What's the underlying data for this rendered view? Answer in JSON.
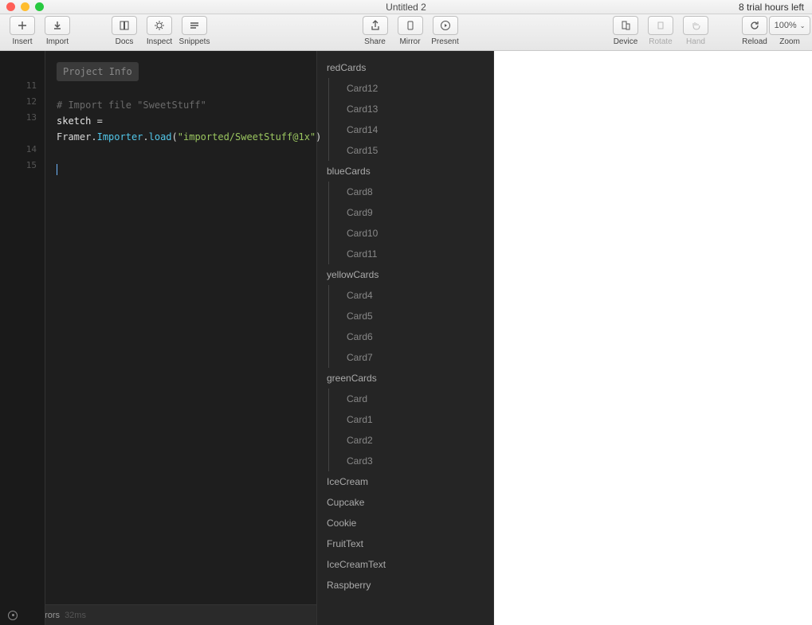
{
  "window": {
    "title": "Untitled 2",
    "trial": "8 trial hours left"
  },
  "toolbar": {
    "insert": "Insert",
    "import": "Import",
    "docs": "Docs",
    "inspect": "Inspect",
    "snippets": "Snippets",
    "share": "Share",
    "mirror": "Mirror",
    "present": "Present",
    "device": "Device",
    "rotate": "Rotate",
    "hand": "Hand",
    "reload": "Reload",
    "zoom": "Zoom",
    "zoom_value": "100%"
  },
  "editor": {
    "project_info": "Project Info",
    "line_numbers": [
      "",
      "11",
      "12",
      "13",
      "",
      "14",
      "15"
    ],
    "code": {
      "comment": "# Import file \"SweetStuff\"",
      "line1_a": "sketch ",
      "line1_b": "= ",
      "line1_c": "Framer",
      "line1_dot1": ".",
      "line1_d": "Importer",
      "line1_dot2": ".",
      "line1_e": "load",
      "line1_paren_open": "(",
      "line1_str": "\"imported/SweetStuff@1x\"",
      "line1_paren_close": ")"
    }
  },
  "status": {
    "errors": "No Errors",
    "time": "32ms"
  },
  "layers": [
    {
      "type": "group",
      "label": "redCards",
      "items": [
        "Card12",
        "Card13",
        "Card14",
        "Card15"
      ]
    },
    {
      "type": "group",
      "label": "blueCards",
      "items": [
        "Card8",
        "Card9",
        "Card10",
        "Card11"
      ]
    },
    {
      "type": "group",
      "label": "yellowCards",
      "items": [
        "Card4",
        "Card5",
        "Card6",
        "Card7"
      ]
    },
    {
      "type": "group",
      "label": "greenCards",
      "items": [
        "Card",
        "Card1",
        "Card2",
        "Card3"
      ]
    },
    {
      "type": "single",
      "label": "IceCream"
    },
    {
      "type": "single",
      "label": "Cupcake"
    },
    {
      "type": "single",
      "label": "Cookie"
    },
    {
      "type": "single",
      "label": "FruitText"
    },
    {
      "type": "single",
      "label": "IceCreamText"
    },
    {
      "type": "single",
      "label": "Raspberry"
    }
  ]
}
